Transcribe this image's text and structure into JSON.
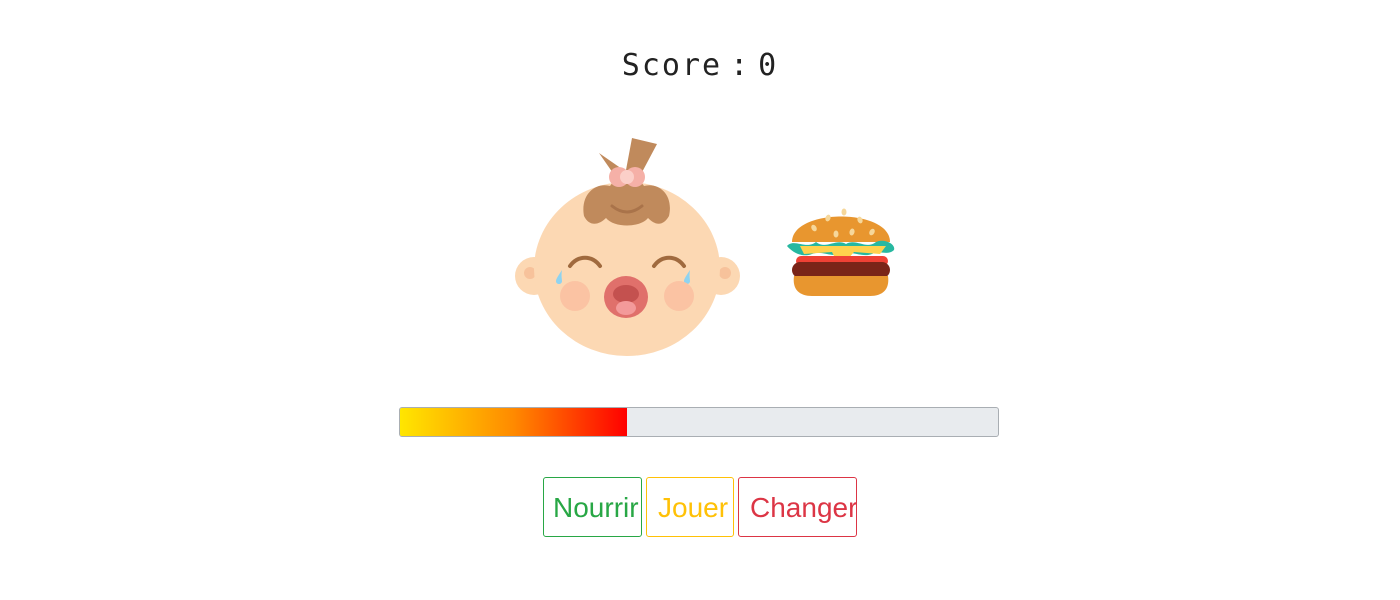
{
  "score": {
    "label": "Score",
    "separator": ":",
    "value": "0"
  },
  "baby": {
    "icon": "crying-baby-icon",
    "mood": "crying"
  },
  "food": {
    "icon": "burger-icon"
  },
  "meter": {
    "level": 0.38,
    "colors": [
      "#ffe600",
      "#ff8a00",
      "#ff0000"
    ]
  },
  "actions": {
    "feed_label": "Nourrir",
    "play_label": "Jouer",
    "change_label": "Changer",
    "feed_color": "#28a745",
    "play_color": "#ffc107",
    "change_color": "#dc3545"
  }
}
